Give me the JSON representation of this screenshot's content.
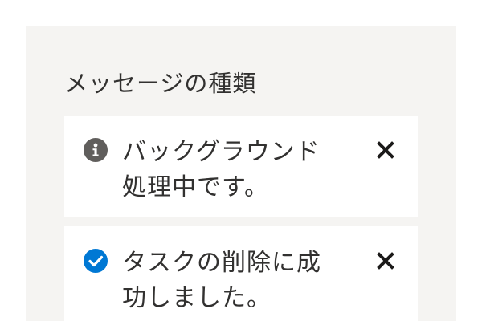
{
  "section": {
    "title": "メッセージの種類"
  },
  "messages": [
    {
      "type": "info",
      "icon": "info-icon",
      "text": "バックグラウンド処理中です。",
      "close_icon": "close-icon"
    },
    {
      "type": "success",
      "icon": "checkmark-circle-icon",
      "text": "タスクの削除に成功しました。",
      "close_icon": "close-icon"
    }
  ],
  "colors": {
    "info_icon": "#605e5c",
    "success_icon": "#0078d4",
    "panel_background": "#f5f4f2",
    "text": "#323130"
  }
}
